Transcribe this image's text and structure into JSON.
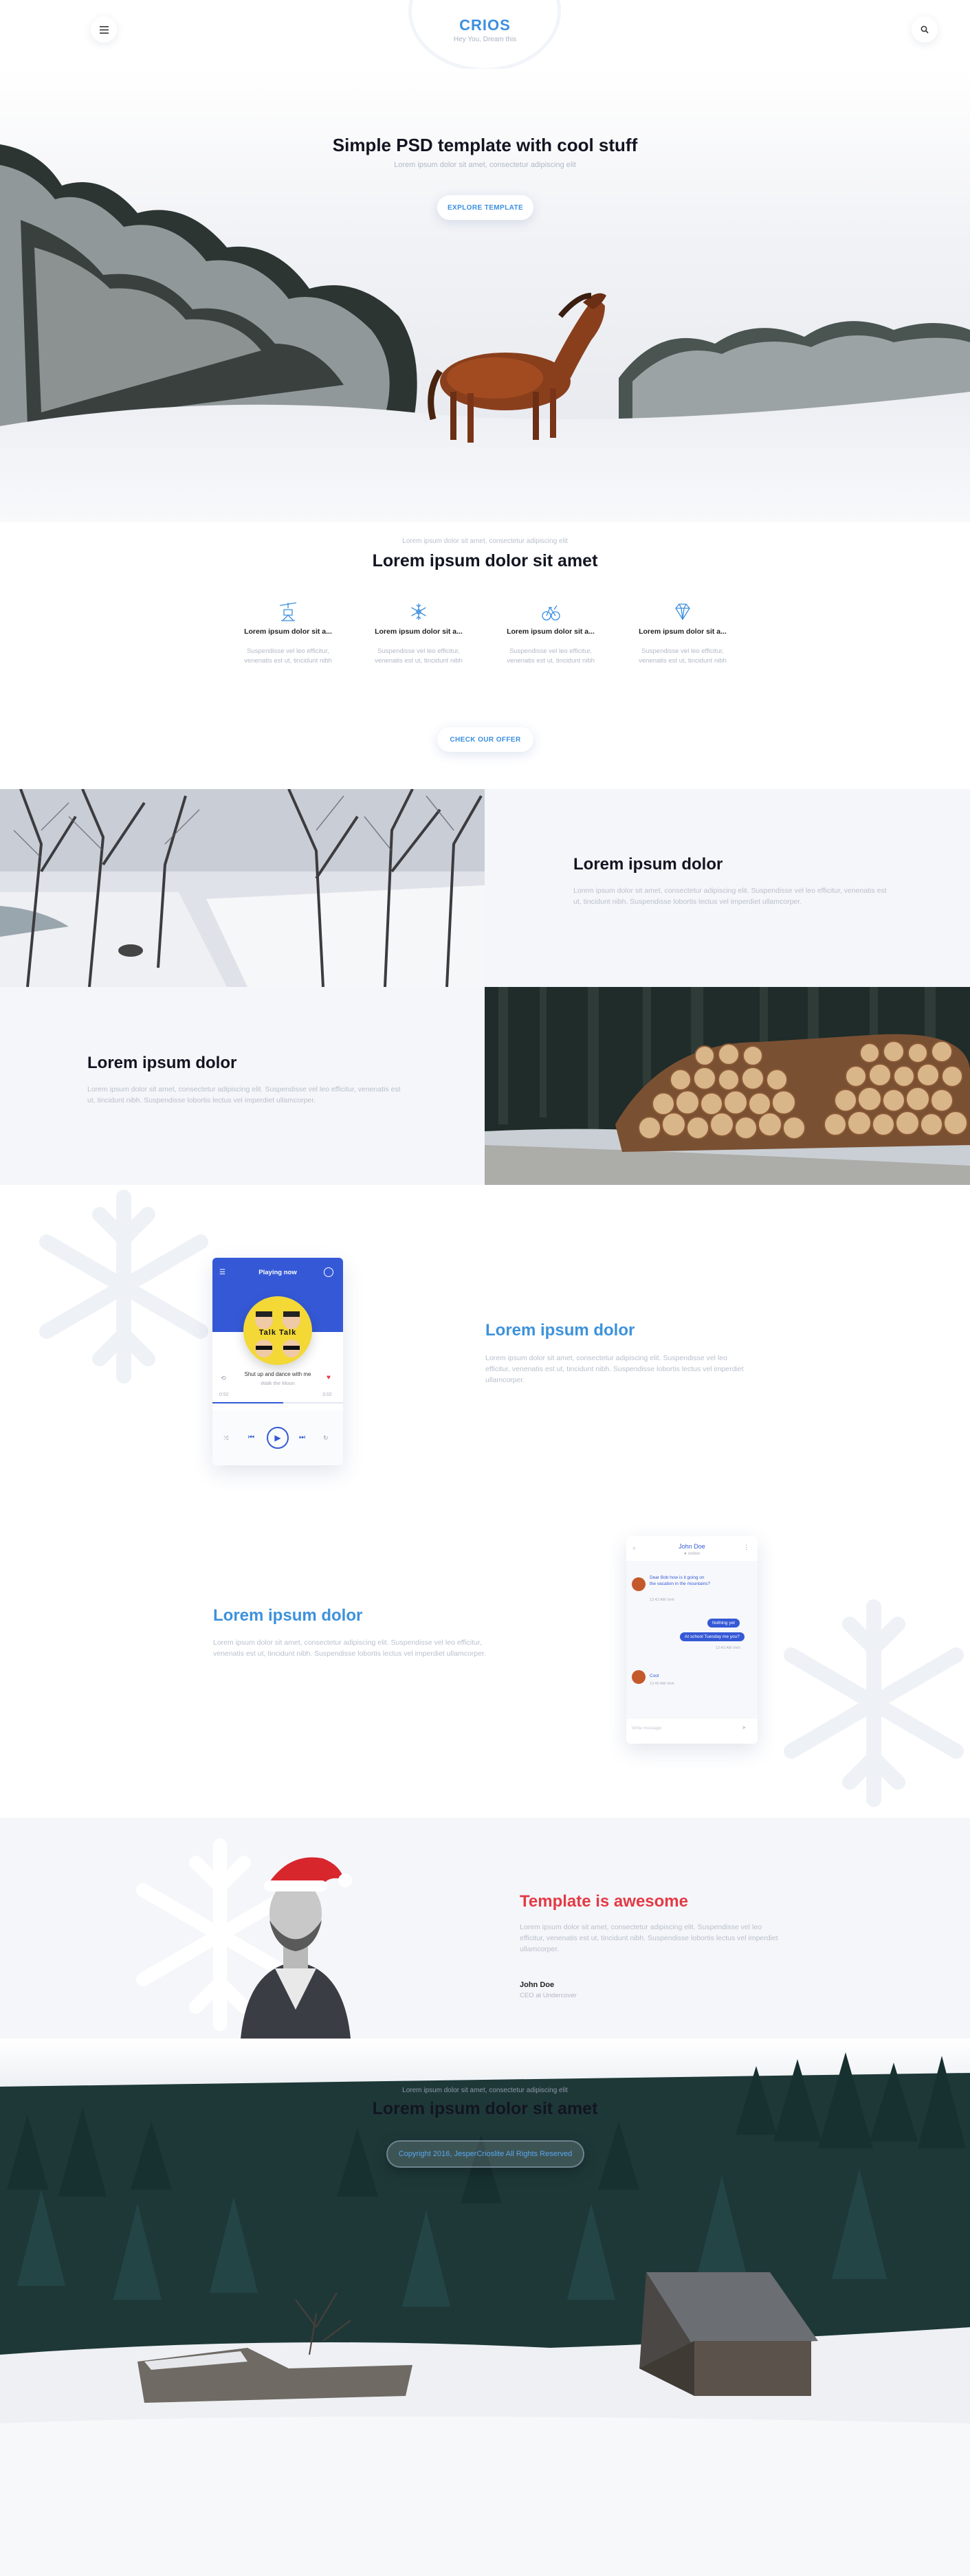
{
  "header": {
    "menu_icon": "hamburger-icon",
    "search_icon": "search-icon",
    "logo": "CRIOS",
    "tagline": "Hey You, Dream this"
  },
  "hero": {
    "title": "Simple PSD template with cool stuff",
    "subtitle": "Lorem ipsum dolor sit amet, consectetur adipiscing elit",
    "button": "EXPLORE TEMPLATE"
  },
  "features": {
    "kicker": "Lorem ipsum dolor sit amet, consectetur adipiscing elit",
    "title": "Lorem ipsum dolor sit amet",
    "items": [
      {
        "icon": "ski-lift-icon",
        "title": "Lorem ipsum dolor sit a...",
        "text": "Suspendisse vel leo efficitur, venenatis est ut, tincidunt nibh"
      },
      {
        "icon": "snowflake-icon",
        "title": "Lorem ipsum dolor sit a...",
        "text": "Suspendisse vel leo efficitur, venenatis est ut, tincidunt nibh"
      },
      {
        "icon": "sled-icon",
        "title": "Lorem ipsum dolor sit a...",
        "text": "Suspendisse vel leo efficitur, venenatis est ut, tincidunt nibh"
      },
      {
        "icon": "diamond-icon",
        "title": "Lorem ipsum dolor sit a...",
        "text": "Suspendisse vel leo efficitur, venenatis est ut, tincidunt nibh"
      }
    ],
    "button": "CHECK OUR OFFER"
  },
  "split1": {
    "title": "Lorem ipsum dolor",
    "text": "Lorem ipsum dolor sit amet, consectetur adipiscing elit. Suspendisse vel leo efficitur, venenatis est ut, tincidunt nibh. Suspendisse lobortis lectus vel imperdiet ullamcorper."
  },
  "split2": {
    "title": "Lorem ipsum dolor",
    "text": "Lorem ipsum dolor sit amet, consectetur adipiscing elit. Suspendisse vel leo efficitur, venenatis est ut, tincidunt nibh. Suspendisse lobortis lectus vel imperdiet ullamcorper."
  },
  "music_app": {
    "header": "Playing now",
    "album_text": "Talk Talk",
    "song": "Shut up and dance with me",
    "artist": "Walk the Moon",
    "time_start": "0:52",
    "time_end": "3:02",
    "progress": 0.54
  },
  "showcase1": {
    "title": "Lorem ipsum dolor",
    "text": "Lorem ipsum dolor sit amet, consectetur adipiscing elit. Suspendisse vel leo efficitur, venenatis est ut, tincidunt nibh. Suspendisse lobortis lectus vel imperdiet ullamcorper."
  },
  "showcase2": {
    "title": "Lorem ipsum dolor",
    "text": "Lorem ipsum dolor sit amet, consectetur adipiscing elit. Suspendisse vel leo efficitur, venenatis est ut, tincidunt nibh. Suspendisse lobortis lectus vel imperdiet ullamcorper."
  },
  "chat_app": {
    "contact": "John Doe",
    "status": "● online",
    "msg1": "Dear Bob how is it going on the vacation in the mountains?",
    "msg1_time": "12:42 AM Vinh",
    "msg2": "Nothing yet",
    "msg3": "At school Tuesday me you?",
    "msg3_time": "12:43 AM Vinh",
    "msg4": "Cool",
    "msg4_time": "12:45 AM Vinh",
    "input_placeholder": "Write message"
  },
  "testimonial": {
    "title": "Template is awesome",
    "text": "Lorem ipsum dolor sit amet, consectetur adipiscing elit. Suspendisse vel leo efficitur, venenatis est ut, tincidunt nibh. Suspendisse lobortis lectus vel imperdiet ullamcorper.",
    "name": "John Doe",
    "role": "CEO at Undercover"
  },
  "footer": {
    "kicker": "Lorem ipsum dolor sit amet, consectetur adipiscing elit",
    "title": "Lorem ipsum dolor sit amet",
    "copyright": "Copyright 2016, JesperCrioslite All Rights Reserved"
  },
  "colors": {
    "accent": "#3b8fe0",
    "heading": "#121521",
    "muted": "#b1b8c6",
    "panel": "#f5f6f9",
    "app_blue": "#3559d6",
    "testimonial_red": "#e33a45"
  }
}
